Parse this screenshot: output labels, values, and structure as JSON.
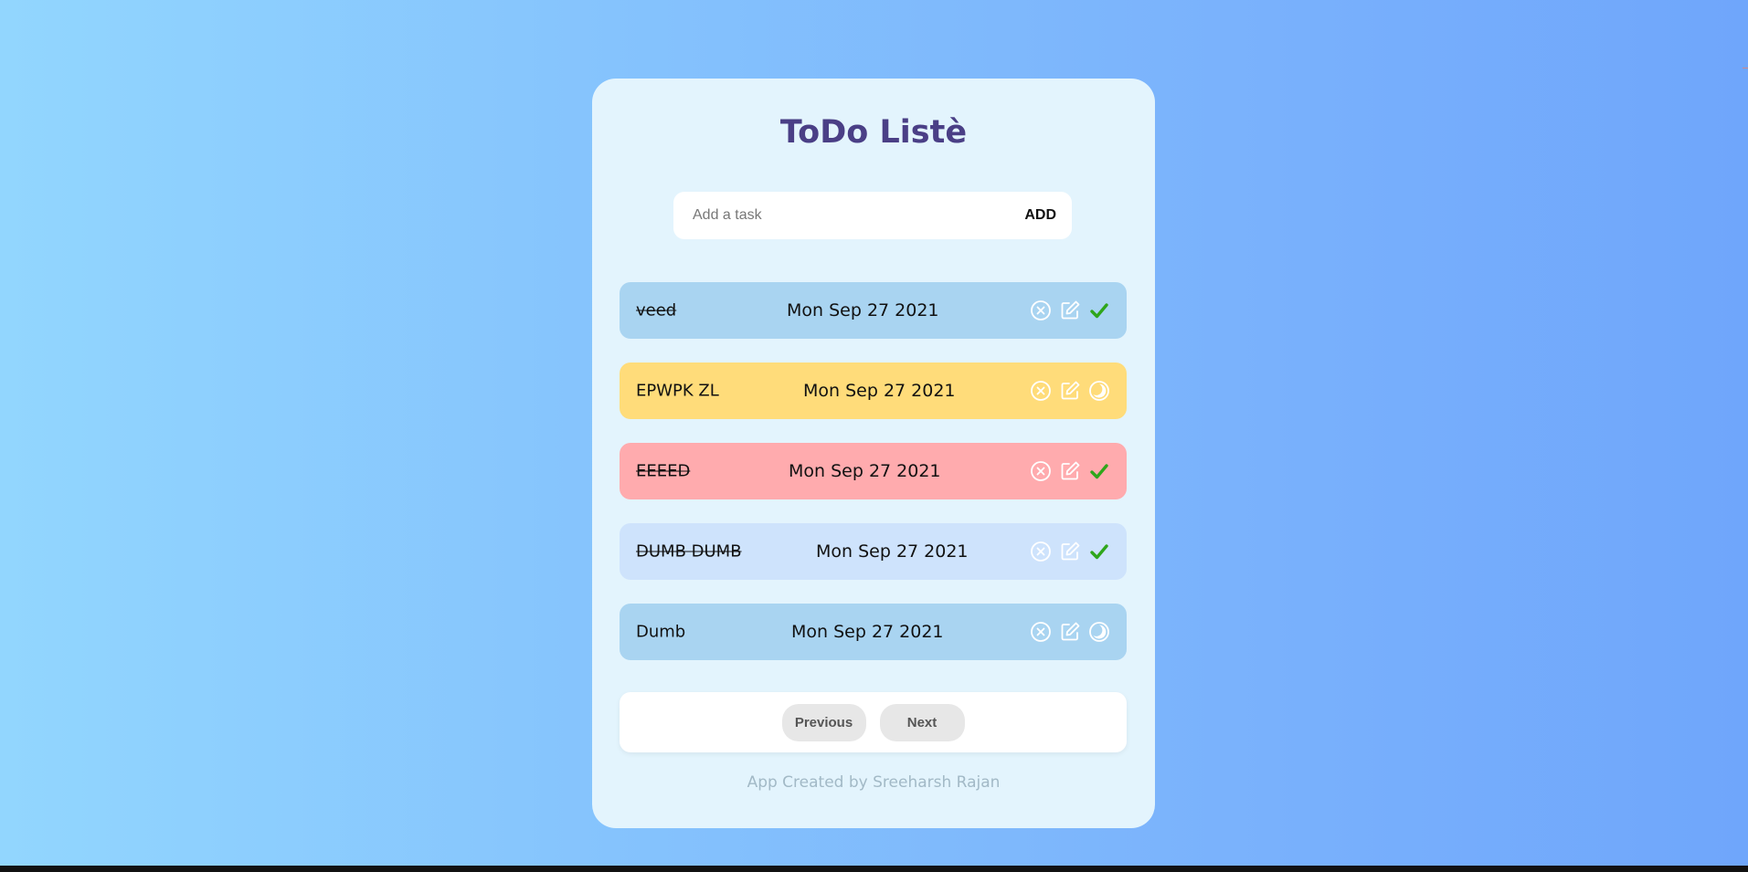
{
  "app": {
    "title": "ToDo Listè",
    "add_placeholder": "Add a task",
    "add_label": "ADD",
    "footer": "App Created by Sreeharsh Rajan"
  },
  "tasks": [
    {
      "text": "veed",
      "date": "Mon Sep 27 2021",
      "done": true,
      "color": "#a9d4f1",
      "status_icon": "check-icon"
    },
    {
      "text": "EPWPK ZL",
      "date": "Mon Sep 27 2021",
      "done": false,
      "color": "#ffdc7a",
      "status_icon": "pending-icon"
    },
    {
      "text": "EEEED",
      "date": "Mon Sep 27 2021",
      "done": true,
      "color": "#ffabae",
      "status_icon": "check-icon"
    },
    {
      "text": "DUMB DUMB",
      "date": "Mon Sep 27 2021",
      "done": true,
      "color": "#cee3fc",
      "status_icon": "check-icon"
    },
    {
      "text": "Dumb",
      "date": "Mon Sep 27 2021",
      "done": false,
      "color": "#a9d4f1",
      "status_icon": "pending-icon"
    }
  ],
  "pagination": {
    "previous_label": "Previous",
    "next_label": "Next"
  },
  "colors": {
    "title": "#4a3f86",
    "check": "#2fa61b",
    "footer": "#a2b9c6"
  }
}
